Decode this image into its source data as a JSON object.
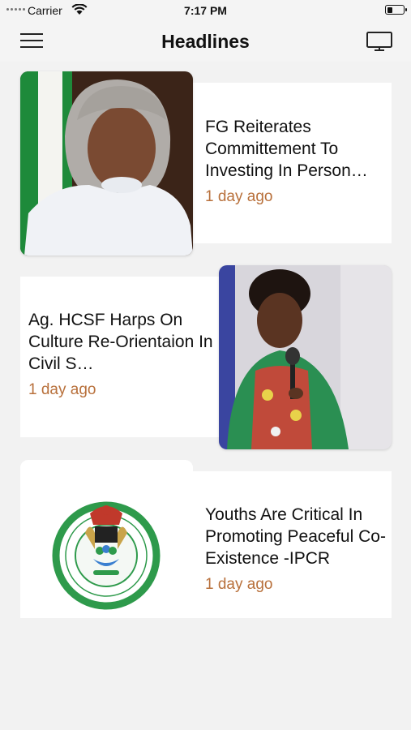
{
  "status_bar": {
    "carrier": "Carrier",
    "time": "7:17 PM",
    "battery_level": 0.35
  },
  "nav": {
    "title": "Headlines",
    "menu_icon": "hamburger-menu-icon",
    "cast_icon": "tv-icon"
  },
  "articles": [
    {
      "title": "FG Reiterates Committement To Investing In Person…",
      "time": "1 day ago"
    },
    {
      "title": "Ag. HCSF Harps On Culture Re-Orientaion In Civil S…",
      "time": "1 day ago"
    },
    {
      "title": "Youths Are Critical In Promoting Peaceful Co-Existence -IPCR",
      "time": "1 day ago"
    }
  ],
  "colors": {
    "accent_time": "#b8703b",
    "background": "#f2f2f2",
    "logo_green": "#2e9a4b"
  }
}
